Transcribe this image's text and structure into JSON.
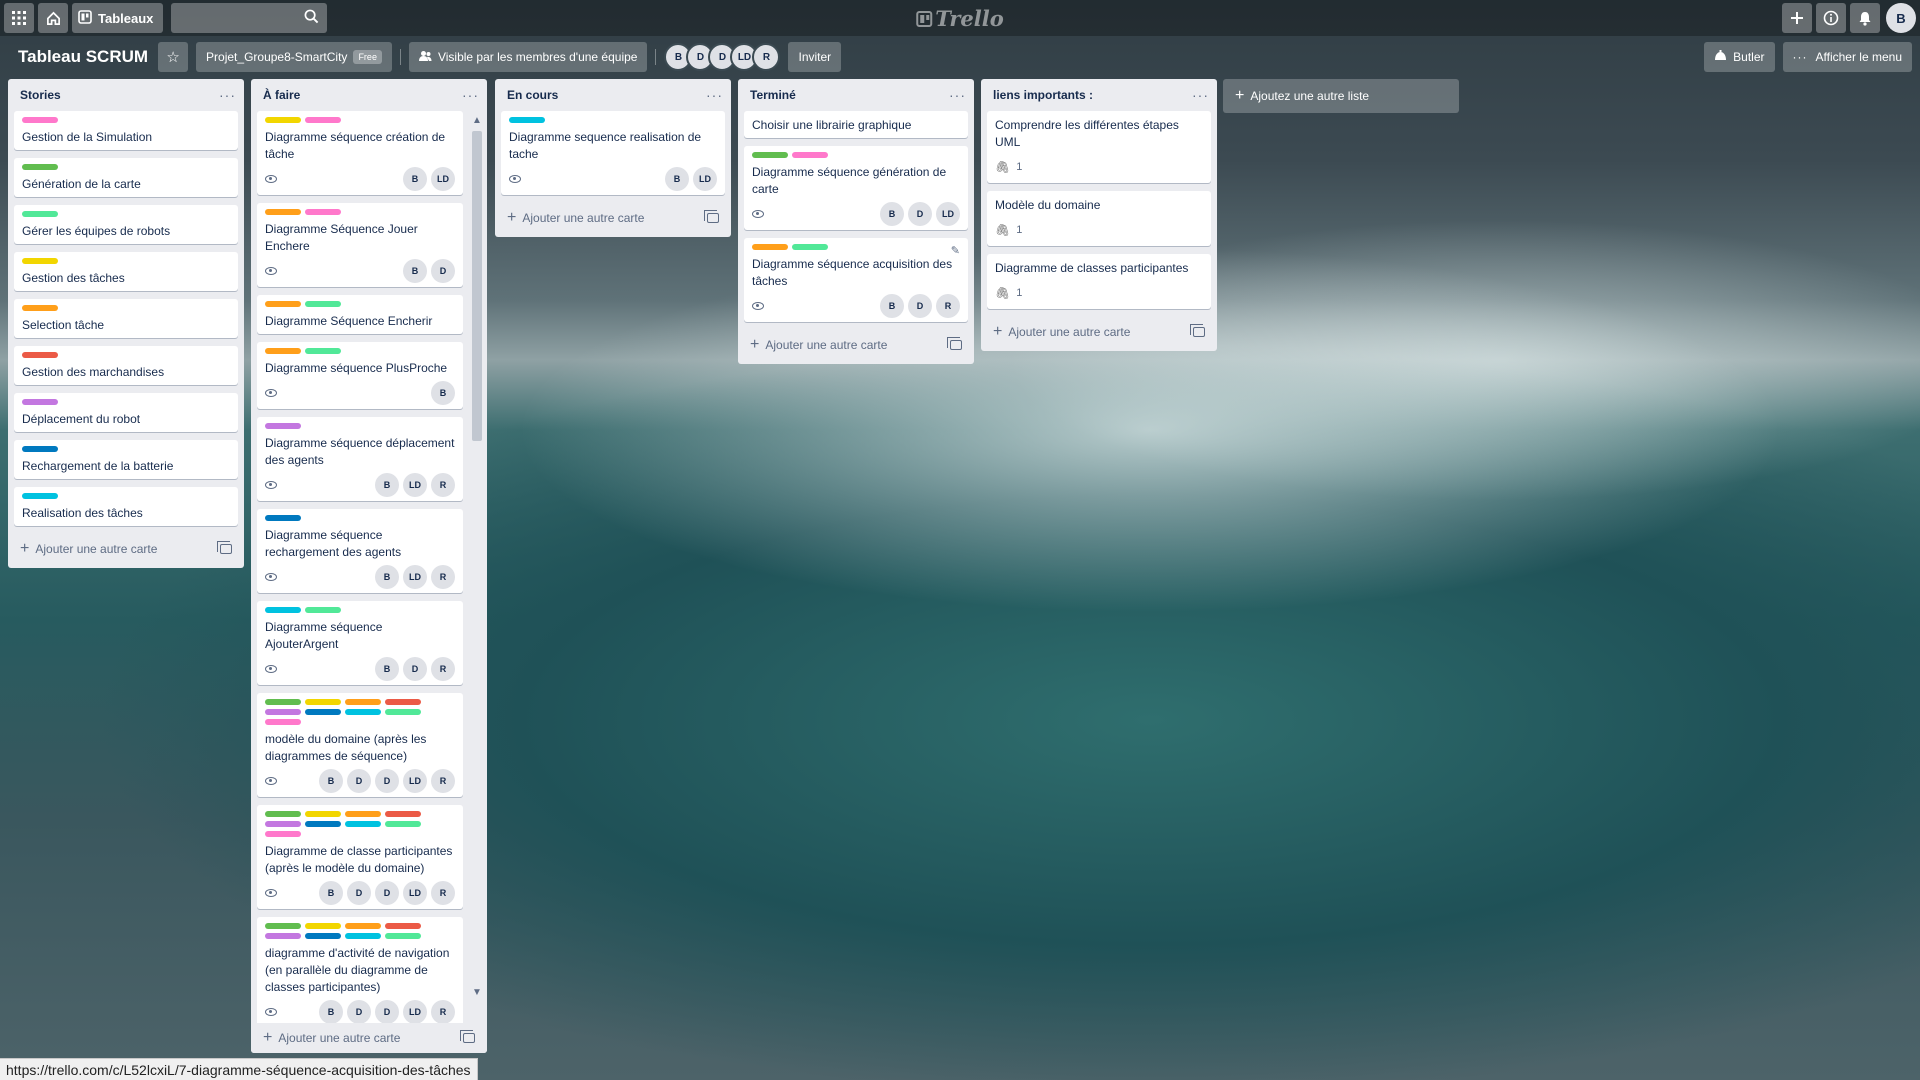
{
  "header": {
    "boards_label": "Tableaux",
    "search_placeholder": "",
    "logo_text": "Trello",
    "user_initial": "B"
  },
  "board": {
    "title": "Tableau SCRUM",
    "team": "Projet_Groupe8-SmartCity",
    "team_badge": "Free",
    "visibility": "Visible par les membres d'une équipe",
    "members": [
      "B",
      "D",
      "D",
      "LD",
      "R"
    ],
    "invite_label": "Inviter",
    "butler_label": "Butler",
    "menu_label": "Afficher le menu"
  },
  "labels_colors": {
    "pink": "#ff78cb",
    "green": "#61bd4f",
    "lime": "#51e898",
    "yellow": "#f2d600",
    "orange": "#ff9f1a",
    "red": "#eb5a46",
    "purple": "#c377e0",
    "blue": "#0079bf",
    "sky": "#00c2e0"
  },
  "lists": [
    {
      "title": "Stories",
      "add_label": "Ajouter une autre carte",
      "cards": [
        {
          "text": "Gestion de la Simulation",
          "labels": [
            "pink"
          ]
        },
        {
          "text": "Génération de la carte",
          "labels": [
            "green"
          ]
        },
        {
          "text": "Gérer les équipes de robots",
          "labels": [
            "lime"
          ]
        },
        {
          "text": "Gestion des tâches",
          "labels": [
            "yellow"
          ]
        },
        {
          "text": "Selection tâche",
          "labels": [
            "orange"
          ]
        },
        {
          "text": "Gestion des marchandises",
          "labels": [
            "red"
          ]
        },
        {
          "text": "Déplacement du robot",
          "labels": [
            "purple"
          ]
        },
        {
          "text": "Rechargement de la batterie",
          "labels": [
            "blue"
          ]
        },
        {
          "text": "Realisation des tâches",
          "labels": [
            "sky"
          ]
        }
      ]
    },
    {
      "title": "À faire",
      "add_label": "Ajouter une autre carte",
      "cards": [
        {
          "text": "Diagramme séquence création de tâche",
          "labels": [
            "yellow",
            "pink"
          ],
          "watch": true,
          "members": [
            "B",
            "LD"
          ]
        },
        {
          "text": "Diagramme Séquence Jouer Enchere",
          "labels": [
            "orange",
            "pink"
          ],
          "watch": true,
          "members": [
            "B",
            "D"
          ]
        },
        {
          "text": "Diagramme Séquence Encherir",
          "labels": [
            "orange",
            "lime"
          ]
        },
        {
          "text": "Diagramme séquence PlusProche",
          "labels": [
            "orange",
            "lime"
          ],
          "watch": true,
          "members": [
            "B"
          ]
        },
        {
          "text": "Diagramme séquence déplacement des agents",
          "labels": [
            "purple"
          ],
          "watch": true,
          "members": [
            "B",
            "LD",
            "R"
          ]
        },
        {
          "text": "Diagramme séquence rechargement des agents",
          "labels": [
            "blue"
          ],
          "watch": true,
          "members": [
            "B",
            "LD",
            "R"
          ]
        },
        {
          "text": "Diagramme séquence AjouterArgent",
          "labels": [
            "sky",
            "lime"
          ],
          "watch": true,
          "members": [
            "B",
            "D",
            "R"
          ]
        },
        {
          "text": "modèle du domaine (après les diagrammes de séquence)",
          "labels": [
            "green",
            "yellow",
            "orange",
            "red",
            "purple",
            "blue",
            "sky",
            "lime",
            "pink"
          ],
          "watch": true,
          "members": [
            "B",
            "D",
            "D",
            "LD",
            "R"
          ]
        },
        {
          "text": "Diagramme de classe participantes (après le modèle du domaine)",
          "labels": [
            "green",
            "yellow",
            "orange",
            "red",
            "purple",
            "blue",
            "sky",
            "lime",
            "pink"
          ],
          "watch": true,
          "members": [
            "B",
            "D",
            "D",
            "LD",
            "R"
          ]
        },
        {
          "text": "diagramme d'activité de navigation (en parallèle du diagramme de classes participantes)",
          "labels": [
            "green",
            "yellow",
            "orange",
            "red",
            "purple",
            "blue",
            "sky",
            "lime"
          ],
          "watch": true,
          "members": [
            "B",
            "D",
            "D",
            "LD",
            "R"
          ]
        }
      ]
    },
    {
      "title": "En cours",
      "add_label": "Ajouter une autre carte",
      "cards": [
        {
          "text": "Diagramme sequence realisation de tache",
          "labels": [
            "sky"
          ],
          "watch": true,
          "members": [
            "B",
            "LD"
          ]
        }
      ]
    },
    {
      "title": "Terminé",
      "add_label": "Ajouter une autre carte",
      "cards": [
        {
          "text": "Choisir une librairie graphique",
          "labels": []
        },
        {
          "text": "Diagramme séquence génération de carte",
          "labels": [
            "green",
            "pink"
          ],
          "watch": true,
          "members": [
            "B",
            "D",
            "LD"
          ]
        },
        {
          "text": "Diagramme séquence acquisition des tâches",
          "labels": [
            "orange",
            "lime"
          ],
          "watch": true,
          "members": [
            "B",
            "D",
            "R"
          ],
          "edit": true
        }
      ]
    },
    {
      "title": "liens importants :",
      "add_label": "Ajouter une autre carte",
      "cards": [
        {
          "text": "Comprendre les différentes étapes UML",
          "labels": [],
          "attachments": "1"
        },
        {
          "text": "Modèle du domaine",
          "labels": [],
          "attachments": "1"
        },
        {
          "text": "Diagramme de classes participantes",
          "labels": [],
          "attachments": "1"
        }
      ]
    }
  ],
  "add_list_label": "Ajoutez une autre liste",
  "status_url": "https://trello.com/c/L52lcxiL/7-diagramme-séquence-acquisition-des-tâches"
}
